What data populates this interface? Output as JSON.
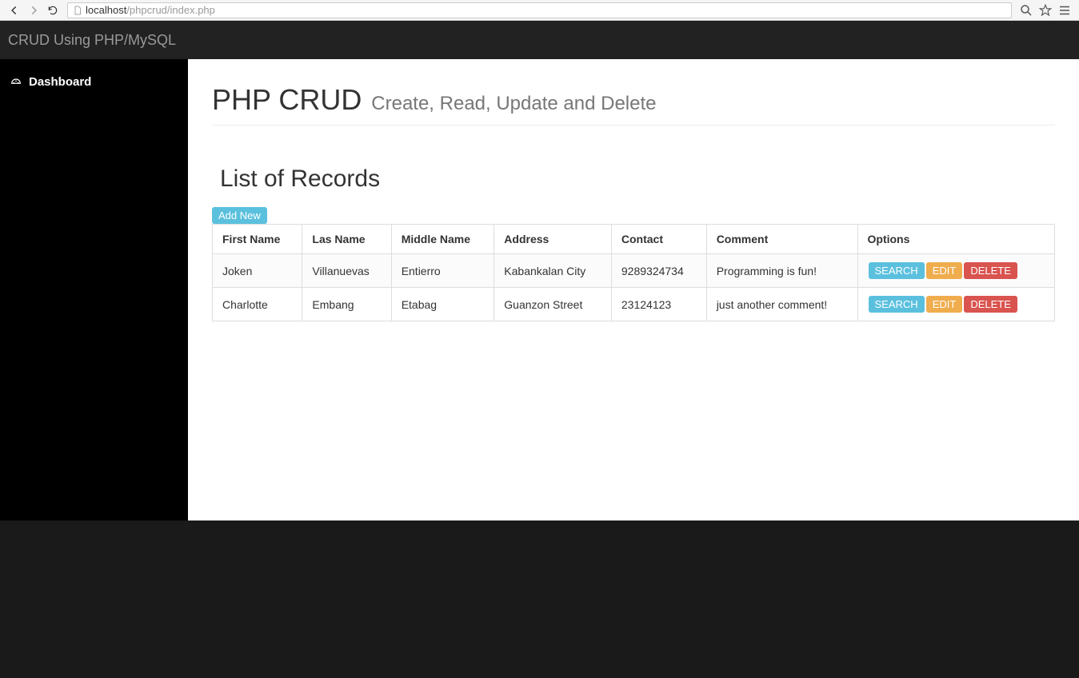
{
  "browser": {
    "url_host": "localhost",
    "url_path": "/phpcrud/index.php"
  },
  "topbar": {
    "title": "CRUD Using PHP/MySQL"
  },
  "sidebar": {
    "items": [
      {
        "label": "Dashboard"
      }
    ]
  },
  "page": {
    "title": "PHP CRUD",
    "subtitle": "Create, Read, Update and Delete",
    "section_title": "List of Records",
    "add_new_label": "Add New"
  },
  "table": {
    "headers": [
      "First Name",
      "Las Name",
      "Middle Name",
      "Address",
      "Contact",
      "Comment",
      "Options"
    ],
    "rows": [
      {
        "first": "Joken",
        "last": "Villanuevas",
        "middle": "Entierro",
        "address": "Kabankalan City",
        "contact": "9289324734",
        "comment": "Programming is fun!"
      },
      {
        "first": "Charlotte",
        "last": "Embang",
        "middle": "Etabag",
        "address": "Guanzon Street",
        "contact": "23124123",
        "comment": "just another comment!"
      }
    ],
    "action_labels": {
      "search": "SEARCH",
      "edit": "EDIT",
      "delete": "DELETE"
    }
  }
}
